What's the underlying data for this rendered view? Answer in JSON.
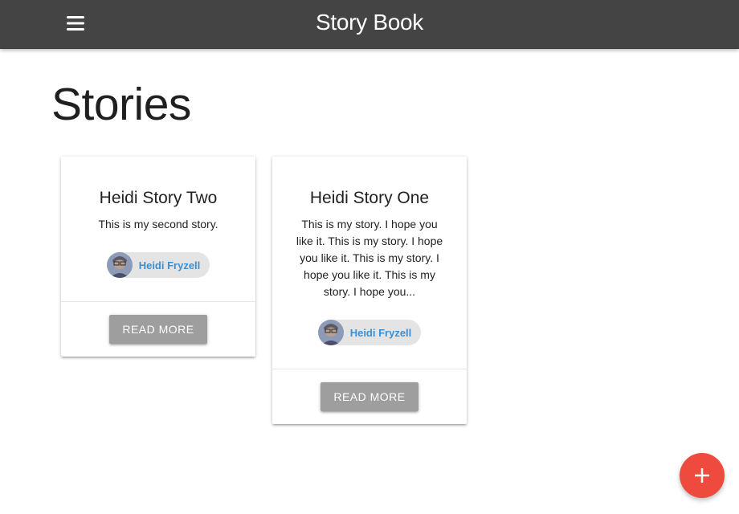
{
  "navbar": {
    "brand": "Story Book",
    "menu_icon": "hamburger-menu-icon",
    "background": "#444444"
  },
  "page": {
    "title": "Stories"
  },
  "stories": [
    {
      "title": "Heidi Story Two",
      "body": "This is my second story.",
      "author": "Heidi Fryzell",
      "action_label": "Read More"
    },
    {
      "title": "Heidi Story One",
      "body": "This is my story. I hope you like it. This is my story. I hope you like it. This is my story. I hope you like it. This is my story. I hope you...",
      "author": "Heidi Fryzell",
      "action_label": "Read More"
    }
  ],
  "fab": {
    "icon": "plus-icon",
    "color": "#ee4a3e"
  },
  "colors": {
    "author_link": "#3d8fd1",
    "button": "#9e9e9e",
    "chip": "#e4e4e4"
  }
}
